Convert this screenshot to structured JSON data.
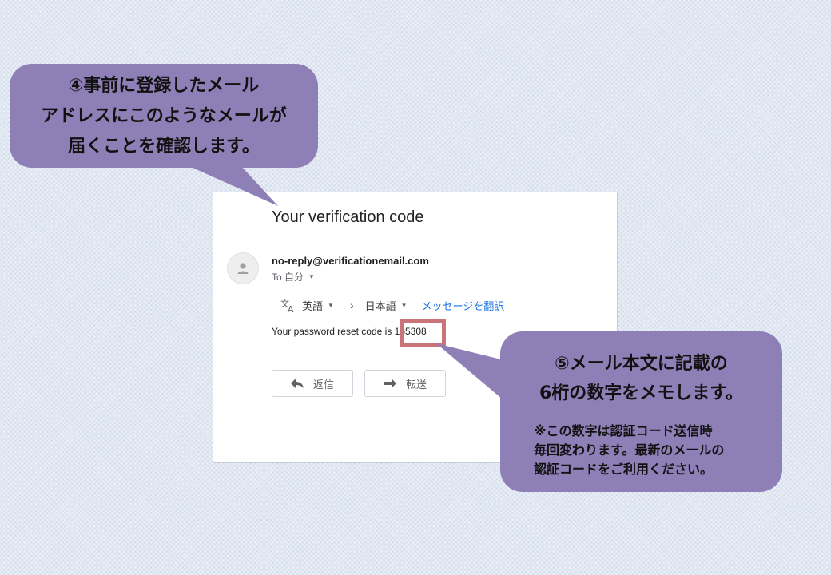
{
  "email": {
    "subject": "Your verification code",
    "sender": "no-reply@verificationemail.com",
    "recipient_label": "To 自分",
    "translate": {
      "from_lang": "英語",
      "to_lang": "日本語",
      "translate_link": "メッセージを翻訳"
    },
    "body_text": "Your password reset code is 165308",
    "buttons": {
      "reply": "返信",
      "forward": "転送"
    }
  },
  "callouts": {
    "step4": [
      "④事前に登録したメール",
      "アドレスにこのようなメールが",
      "届くことを確認します。"
    ],
    "step5": {
      "main": [
        "⑤メール本文に記載の",
        "6桁の数字をメモします。"
      ],
      "note": [
        "※この数字は認証コード送信時",
        "毎回変わります。最新のメールの",
        "認証コードをご利用ください。"
      ]
    }
  },
  "colors": {
    "callout_bg": "#8e80b6",
    "highlight_border": "#c8747a",
    "link": "#1a73e8"
  }
}
